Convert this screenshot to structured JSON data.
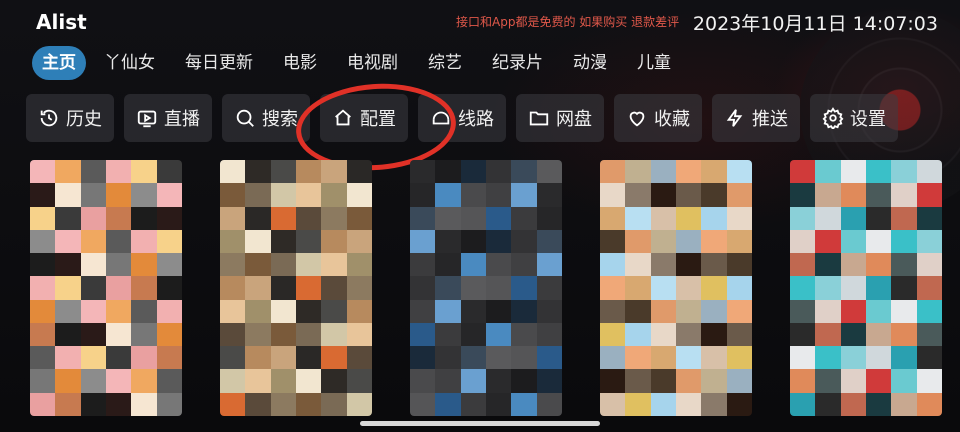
{
  "header": {
    "title": "Alist",
    "notice": "接口和App都是免费的 如果购买 退款差评",
    "datetime": "2023年10月11日 14:07:03"
  },
  "tabs": [
    {
      "label": "主页",
      "active": true
    },
    {
      "label": "丫仙女"
    },
    {
      "label": "每日更新"
    },
    {
      "label": "电影"
    },
    {
      "label": "电视剧"
    },
    {
      "label": "综艺"
    },
    {
      "label": "纪录片"
    },
    {
      "label": "动漫"
    },
    {
      "label": "儿童"
    }
  ],
  "actions": [
    {
      "label": "历史",
      "icon": "history-icon"
    },
    {
      "label": "直播",
      "icon": "tv-icon"
    },
    {
      "label": "搜索",
      "icon": "search-icon"
    },
    {
      "label": "配置",
      "icon": "home-icon"
    },
    {
      "label": "线路",
      "icon": "route-icon"
    },
    {
      "label": "网盘",
      "icon": "folder-icon"
    },
    {
      "label": "收藏",
      "icon": "heart-icon"
    },
    {
      "label": "推送",
      "icon": "bolt-icon"
    },
    {
      "label": "设置",
      "icon": "gear-icon"
    }
  ],
  "colors": {
    "accent": "#2e7fb8",
    "notice": "#e0584a",
    "annotation": "#e03127"
  },
  "posters": [
    {
      "palette": [
        "#f4b6b8",
        "#f2b0b0",
        "#e9a0a0",
        "#2a1a18",
        "#e38a3a",
        "#f0a860",
        "#f7d28a",
        "#c77a50",
        "#f6e6d2",
        "#8c8c8c",
        "#5a5a5a",
        "#3a3a3a",
        "#1c1c1c",
        "#777"
      ]
    },
    {
      "palette": [
        "#d2c7a7",
        "#f2e6d0",
        "#b78a5e",
        "#d96a32",
        "#7a5a3a",
        "#e8c59a",
        "#2e2a26",
        "#c9a47c",
        "#5a4a3a",
        "#7a6a55",
        "#a0906a",
        "#4a4a48",
        "#2a2826",
        "#8c7a60"
      ]
    },
    {
      "palette": [
        "#3b3b3d",
        "#4a4a4c",
        "#2a2a2c",
        "#333335",
        "#555557",
        "#262628",
        "#404042",
        "#1c1c1e",
        "#3a4a5a",
        "#2a5a8a",
        "#4a8ac0",
        "#6aa0d0",
        "#1a2a3a",
        "#5a5a5c"
      ]
    },
    {
      "palette": [
        "#b8dff2",
        "#a6d4ec",
        "#2a1a12",
        "#e09a6a",
        "#f0a878",
        "#d8c0a8",
        "#e8d8c8",
        "#6a5a4a",
        "#c0b090",
        "#d8a870",
        "#e0c060",
        "#8a7a6a",
        "#4a3a2a",
        "#9ab0c0"
      ]
    },
    {
      "palette": [
        "#e8eaec",
        "#d0d8dc",
        "#c06850",
        "#e08a5a",
        "#d03a3a",
        "#3ac0c8",
        "#2aa0b0",
        "#1a3a40",
        "#4a5a5a",
        "#6acad0",
        "#8ad0d8",
        "#2a2a2a",
        "#c8a890",
        "#e0d0c8"
      ]
    }
  ]
}
